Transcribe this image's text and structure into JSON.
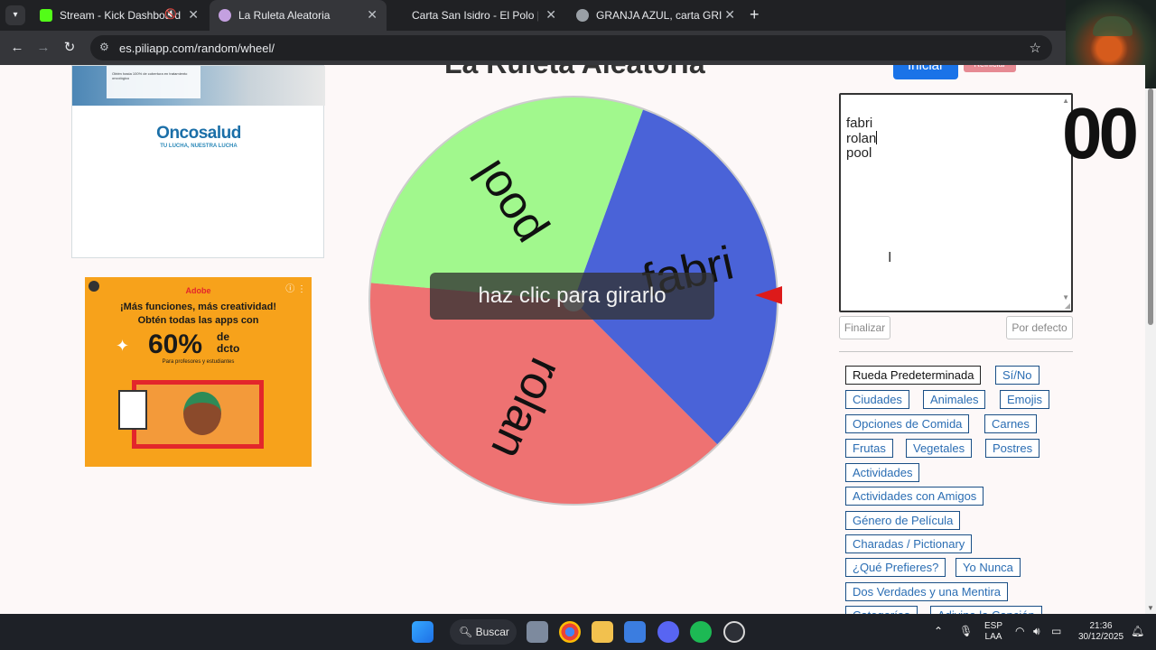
{
  "browser": {
    "tabs": [
      {
        "title": "Stream - Kick Dashboard",
        "favicon_color": "#53fc18",
        "active": false
      },
      {
        "title": "La Ruleta Aleatoria",
        "favicon_color": "#c4a0e0",
        "active": true
      },
      {
        "title": "Carta San Isidro - El Polo | Granja",
        "favicon_color": "",
        "active": false
      },
      {
        "title": "GRANJA AZUL, carta GRILL pág",
        "favicon_color": "#9aa0a6",
        "active": false
      }
    ],
    "url": "es.piliapp.com/random/wheel/"
  },
  "ads": {
    "top": {
      "brand": "ncosalud",
      "brand_initial": "O",
      "tagline": "TU LUCHA, NUESTRA LUCHA",
      "card_text": "Obtén hasta 100% de cobertura en tratamiento oncológico"
    },
    "bottom": {
      "brand": "Adobe",
      "line1": "¡Más funciones, más creatividad!",
      "line2": "Obtén todas las apps con",
      "percent": "60%",
      "de": "de",
      "dcto": "dcto",
      "sub": "Para profesores y estudiantes"
    }
  },
  "page": {
    "title": "La Ruleta Aleatoria",
    "start_label": "Iniciar",
    "reset_label": "Reiniciar",
    "spin_hint": "haz clic para girarlo",
    "counter": "00",
    "names": [
      "fabri",
      "rolan",
      "pool"
    ],
    "finish_label": "Finalizar",
    "default_label": "Por defecto"
  },
  "wheel": {
    "segments": [
      {
        "label": "fabri",
        "color": "#4a63d8",
        "start_deg": 20,
        "end_deg": 135
      },
      {
        "label": "rolan",
        "color": "#ee7272",
        "start_deg": 135,
        "end_deg": 275
      },
      {
        "label": "pool",
        "color": "#a1f88d",
        "start_deg": 275,
        "end_deg": 380
      }
    ],
    "pointer_color": "#dd1a1a"
  },
  "presets": [
    {
      "label": "Rueda Predeterminada",
      "selected": true
    },
    {
      "label": "Sí/No"
    },
    {
      "label": "Ciudades"
    },
    {
      "label": "Animales"
    },
    {
      "label": "Emojis"
    },
    {
      "label": "Opciones de Comida"
    },
    {
      "label": "Carnes"
    },
    {
      "label": "Frutas"
    },
    {
      "label": "Vegetales"
    },
    {
      "label": "Postres"
    },
    {
      "label": "Actividades"
    },
    {
      "label": "Actividades con Amigos"
    },
    {
      "label": "Género de Película"
    },
    {
      "label": "Charadas / Pictionary"
    },
    {
      "label": "¿Qué Prefieres?"
    },
    {
      "label": "Yo Nunca"
    },
    {
      "label": "Dos Verdades y una Mentira"
    },
    {
      "label": "Categorías"
    },
    {
      "label": "Adivina la Canción"
    }
  ],
  "taskbar": {
    "search_label": "Buscar",
    "lang_top": "ESP",
    "lang_bottom": "LAA",
    "time": "21:36",
    "date": "30/12/2025"
  }
}
